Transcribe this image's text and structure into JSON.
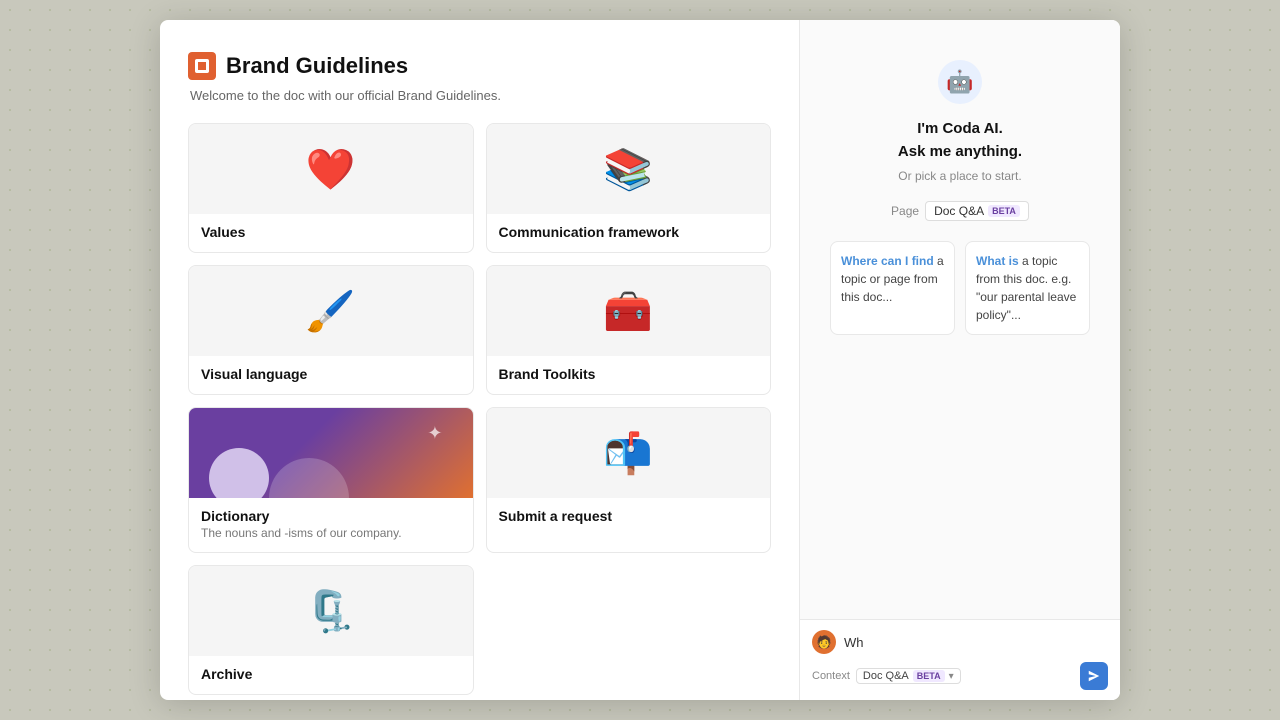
{
  "header": {
    "title": "Brand Guidelines",
    "subtitle": "Welcome to the doc with our official Brand Guidelines."
  },
  "cards": [
    {
      "id": "values",
      "label": "Values",
      "description": "",
      "icon": "❤️",
      "bg": "light"
    },
    {
      "id": "communication-framework",
      "label": "Communication framework",
      "description": "",
      "icon": "📚",
      "bg": "light"
    },
    {
      "id": "visual-language",
      "label": "Visual language",
      "description": "",
      "icon": "🖌️",
      "bg": "light"
    },
    {
      "id": "brand-toolkits",
      "label": "Brand Toolkits",
      "description": "",
      "icon": "🧰",
      "bg": "light"
    },
    {
      "id": "dictionary",
      "label": "Dictionary",
      "description": "The nouns and -isms of our company.",
      "icon": "",
      "bg": "dictionary"
    },
    {
      "id": "submit-request",
      "label": "Submit a request",
      "description": "",
      "icon": "📬",
      "bg": "light"
    },
    {
      "id": "archive",
      "label": "Archive",
      "description": "",
      "icon": "🗜️",
      "bg": "light"
    }
  ],
  "ai": {
    "greeting_line1": "I'm Coda AI.",
    "greeting_line2": "Ask me anything.",
    "subtext": "Or pick a place to start.",
    "context_label": "Page",
    "tab_page": "Page",
    "tab_docqa": "Doc Q&A",
    "beta_label": "BETA",
    "suggestion1_highlight": "Where can I find",
    "suggestion1_rest": " a topic or page from this doc...",
    "suggestion2_highlight": "What is",
    "suggestion2_rest": " a topic from this doc. e.g. \"our parental leave policy\"...",
    "context_row_label": "Context",
    "context_docqa_label": "Doc Q&A",
    "context_beta_label": "BETA",
    "chat_placeholder": "Wh",
    "send_icon": "send"
  },
  "colors": {
    "accent_orange": "#e06030",
    "accent_blue": "#3a7bd5",
    "accent_purple": "#6a3fa0",
    "beta_bg": "#f0e8ff",
    "beta_text": "#6a3fa0"
  }
}
